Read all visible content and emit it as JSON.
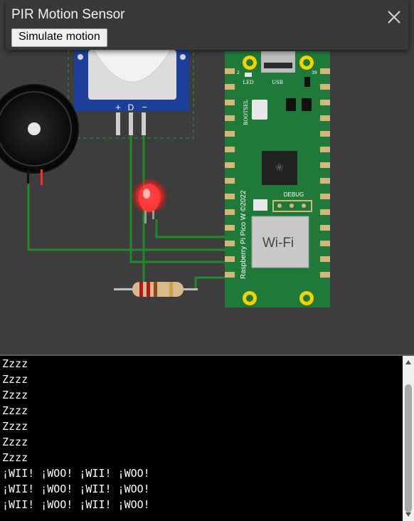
{
  "dialog": {
    "title": "PIR Motion Sensor",
    "simulate_label": "Simulate motion",
    "close_icon": "close-icon"
  },
  "board": {
    "name_label": "Raspberry Pi Pico W ©2022",
    "led_label": "LED",
    "usb_label": "USB",
    "bootsel_label": "BOOTSEL",
    "debug_label": "DEBUG",
    "wifi_label": "Wi-Fi",
    "pin_2_label": "2",
    "pin_39_label": "39"
  },
  "pir": {
    "plus_label": "+",
    "d_label": "D",
    "minus_label": "−"
  },
  "console": {
    "lines": [
      "Zzzz",
      "Zzzz",
      "Zzzz",
      "Zzzz",
      "Zzzz",
      "Zzzz",
      "Zzzz",
      "¡WII! ¡WOO! ¡WII! ¡WOO!",
      "¡WII! ¡WOO! ¡WII! ¡WOO!",
      "¡WII! ¡WOO! ¡WII! ¡WOO!"
    ]
  },
  "colors": {
    "board_green": "#1f7a3a",
    "wire_green": "#1e8a2a",
    "led_red": "#ff3a3a",
    "pin_yellow": "#f2d300",
    "console_bg": "#000000"
  }
}
